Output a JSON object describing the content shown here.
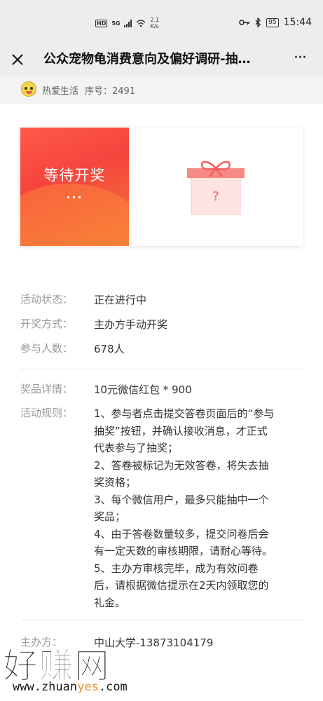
{
  "status_bar": {
    "hd": "HD",
    "network": "5G",
    "speed_value": "2.1",
    "speed_unit": "K/s",
    "battery": "95",
    "time": "15:44"
  },
  "nav": {
    "title": "公众宠物龟消费意向及偏好调研-抽…",
    "more": "···"
  },
  "author": {
    "name": "热爱生活",
    "seq": "序号：2491"
  },
  "prize": {
    "banner_text": "等待开奖",
    "banner_dots": "···"
  },
  "info": {
    "status_label": "活动状态：",
    "status_value": "正在进行中",
    "draw_label": "开奖方式：",
    "draw_value": "主办方手动开奖",
    "count_label": "参与人数：",
    "count_value": "678人",
    "detail_label": "奖品详情：",
    "detail_value": "10元微信红包 * 900",
    "rules_label": "活动规则：",
    "rules_lines": [
      "1、参与者点击提交答卷页面后的“参与",
      "抽奖”按钮，并确认接收消息，才正式",
      "代表参与了抽奖；",
      "2、答卷被标记为无效答卷，将失去抽",
      "奖资格；",
      "3、每个微信用户，最多只能抽中一个",
      "奖品；",
      "4、由于答卷数量较多，提交问卷后会",
      "有一定天数的审核期限，请耐心等待。",
      "5、主办方审核完毕，成为有效问卷",
      "后，请根据微信提示在2天内领取您的",
      "礼金。"
    ],
    "host_label": "主办方：",
    "host_value": "中山大学-13873104179"
  },
  "watermark": {
    "big": "好赚网",
    "url_a": "www.zhuan",
    "url_b": "yes",
    "url_c": ".com"
  },
  "colors": {
    "banner_start": "#ff5a4a",
    "banner_end": "#f47a35",
    "gift": "#f06a6a"
  }
}
